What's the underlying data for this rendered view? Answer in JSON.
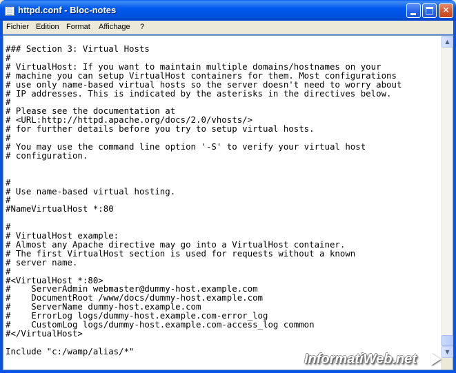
{
  "window": {
    "title": "httpd.conf - Bloc-notes",
    "minimize_glyph": "",
    "close_glyph": "✕"
  },
  "menu": {
    "fichier": "Fichier",
    "edition": "Edition",
    "format": "Format",
    "affichage": "Affichage",
    "help": "?"
  },
  "editor": {
    "lines": [
      "### Section 3: Virtual Hosts",
      "#",
      "# VirtualHost: If you want to maintain multiple domains/hostnames on your",
      "# machine you can setup VirtualHost containers for them. Most configurations",
      "# use only name-based virtual hosts so the server doesn't need to worry about",
      "# IP addresses. This is indicated by the asterisks in the directives below.",
      "#",
      "# Please see the documentation at",
      "# <URL:http://httpd.apache.org/docs/2.0/vhosts/>",
      "# for further details before you try to setup virtual hosts.",
      "#",
      "# You may use the command line option '-S' to verify your virtual host",
      "# configuration.",
      "",
      "",
      "#",
      "# Use name-based virtual hosting.",
      "#",
      "#NameVirtualHost *:80",
      "",
      "#",
      "# VirtualHost example:",
      "# Almost any Apache directive may go into a VirtualHost container.",
      "# The first VirtualHost section is used for requests without a known",
      "# server name.",
      "#",
      "#<VirtualHost *:80>",
      "#    ServerAdmin webmaster@dummy-host.example.com",
      "#    DocumentRoot /www/docs/dummy-host.example.com",
      "#    ServerName dummy-host.example.com",
      "#    ErrorLog logs/dummy-host.example.com-error_log",
      "#    CustomLog logs/dummy-host.example.com-access_log common",
      "#</VirtualHost>",
      "",
      "Include \"c:/wamp/alias/*\""
    ]
  },
  "scrollbar": {
    "up_glyph": "▲",
    "down_glyph": "▼"
  },
  "watermark": {
    "text": "InformatiWeb.net"
  }
}
